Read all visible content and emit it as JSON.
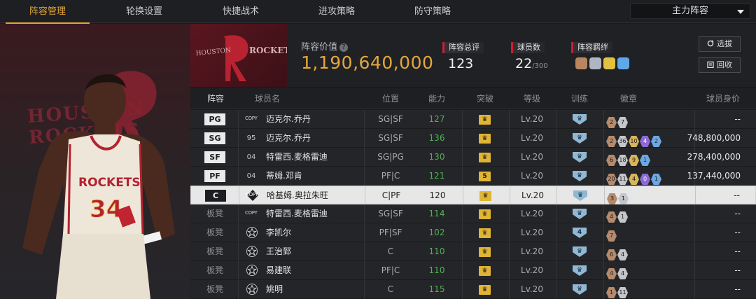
{
  "nav": {
    "tabs": [
      "阵容管理",
      "轮换设置",
      "快捷战术",
      "进攻策略",
      "防守策略"
    ],
    "active_index": 0,
    "lineup_select": "主力阵容"
  },
  "banner": {
    "team_logo_text": "ROCKETS",
    "value_label": "阵容价值",
    "value": "1,190,640,000",
    "rating_label": "阵容总评",
    "rating": "123",
    "players_label": "球员数",
    "players_count": "22",
    "players_max": "/300",
    "bond_label": "阵容羁绊",
    "select_btn": "选拔",
    "recycle_btn": "回收"
  },
  "player_art": {
    "bg_text": "HOUSTON ROCKETS",
    "jersey_name": "ROCKETS",
    "jersey_number": "34"
  },
  "table": {
    "headers": [
      "阵容",
      "球员名",
      "位置",
      "能力",
      "突破",
      "等级",
      "训练",
      "徽章",
      "球员身价"
    ],
    "rows": [
      {
        "slot": "PG",
        "starter": true,
        "card": "COPY",
        "name": "迈克尔.乔丹",
        "pos": "SG|SF",
        "ability": "127",
        "break": "",
        "level": "Lv.20",
        "train": "",
        "badges": [
          [
            "bronze",
            "2"
          ],
          [
            "silver",
            "7"
          ]
        ],
        "salary": "--"
      },
      {
        "slot": "SG",
        "starter": true,
        "card": "95",
        "name": "迈克尔.乔丹",
        "pos": "SG|SF",
        "ability": "136",
        "break": "",
        "level": "Lv.20",
        "train": "",
        "badges": [
          [
            "bronze",
            "2"
          ],
          [
            "silver",
            "36"
          ],
          [
            "gold",
            "10"
          ],
          [
            "purple",
            "4"
          ],
          [
            "blue",
            "2"
          ]
        ],
        "salary": "748,800,000"
      },
      {
        "slot": "SF",
        "starter": true,
        "card": "04",
        "name": "特雷西.麦格雷迪",
        "pos": "SG|PG",
        "ability": "130",
        "break": "",
        "level": "Lv.20",
        "train": "",
        "badges": [
          [
            "bronze",
            "6"
          ],
          [
            "silver",
            "18"
          ],
          [
            "gold",
            "9"
          ],
          [
            "blue",
            "1"
          ]
        ],
        "salary": "278,400,000"
      },
      {
        "slot": "PF",
        "starter": true,
        "card": "04",
        "name": "蒂姆.邓肯",
        "pos": "PF|C",
        "ability": "121",
        "break": "5",
        "level": "Lv.20",
        "train": "",
        "badges": [
          [
            "bronze",
            "20"
          ],
          [
            "silver",
            "11"
          ],
          [
            "gold",
            "4"
          ],
          [
            "purple",
            "0"
          ],
          [
            "blue",
            "1"
          ]
        ],
        "salary": "137,440,000"
      },
      {
        "slot": "C",
        "starter": true,
        "selected": true,
        "card": "COPY",
        "name": "哈基姆.奥拉朱旺",
        "pos": "C|PF",
        "ability": "120",
        "break": "",
        "level": "Lv.20",
        "train": "",
        "badges": [
          [
            "bronze",
            "3"
          ],
          [
            "silver",
            "1"
          ]
        ],
        "salary": "--"
      },
      {
        "slot": "板凳",
        "starter": false,
        "card": "COPY",
        "name": "特雷西.麦格雷迪",
        "pos": "SG|SF",
        "ability": "114",
        "break": "",
        "level": "Lv.20",
        "train": "",
        "badges": [
          [
            "bronze",
            "4"
          ],
          [
            "silver",
            "1"
          ]
        ],
        "salary": "--"
      },
      {
        "slot": "板凳",
        "starter": false,
        "card": "star",
        "name": "李凯尔",
        "pos": "PF|SF",
        "ability": "102",
        "break": "",
        "level": "Lv.20",
        "train": "4",
        "badges": [
          [
            "bronze",
            "7"
          ]
        ],
        "salary": "--"
      },
      {
        "slot": "板凳",
        "starter": false,
        "card": "star",
        "name": "王治郅",
        "pos": "C",
        "ability": "110",
        "break": "",
        "level": "Lv.20",
        "train": "",
        "badges": [
          [
            "bronze",
            "6"
          ],
          [
            "silver",
            "4"
          ]
        ],
        "salary": "--"
      },
      {
        "slot": "板凳",
        "starter": false,
        "card": "star",
        "name": "易建联",
        "pos": "PF|C",
        "ability": "110",
        "break": "",
        "level": "Lv.20",
        "train": "",
        "badges": [
          [
            "bronze",
            "4"
          ],
          [
            "silver",
            "4"
          ]
        ],
        "salary": "--"
      },
      {
        "slot": "板凳",
        "starter": false,
        "card": "star",
        "name": "姚明",
        "pos": "C",
        "ability": "115",
        "break": "",
        "level": "Lv.20",
        "train": "",
        "badges": [
          [
            "bronze",
            "1"
          ],
          [
            "silver",
            "11"
          ]
        ],
        "salary": "--"
      }
    ]
  },
  "colors": {
    "accent": "#e2a43a",
    "red": "#c8202d",
    "ability_green": "#4fb256"
  }
}
